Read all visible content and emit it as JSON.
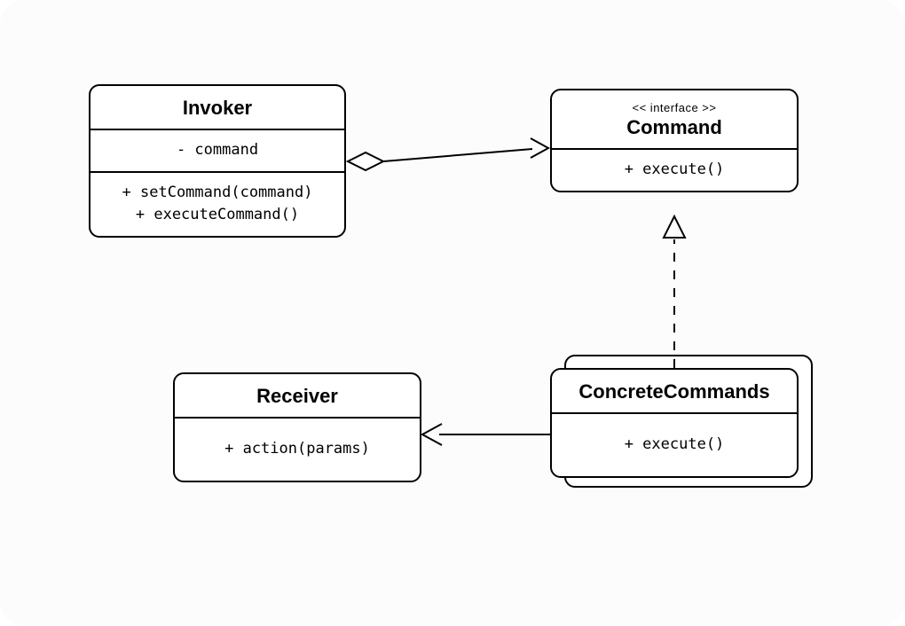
{
  "diagram": {
    "invoker": {
      "title": "Invoker",
      "attr1": "- command",
      "op1": "+ setCommand(command)",
      "op2": "+ executeCommand()"
    },
    "command": {
      "stereotype": "<< interface >>",
      "title": "Command",
      "op1": "+ execute()"
    },
    "concrete": {
      "title": "ConcreteCommands",
      "op1": "+ execute()"
    },
    "receiver": {
      "title": "Receiver",
      "op1": "+ action(params)"
    }
  }
}
